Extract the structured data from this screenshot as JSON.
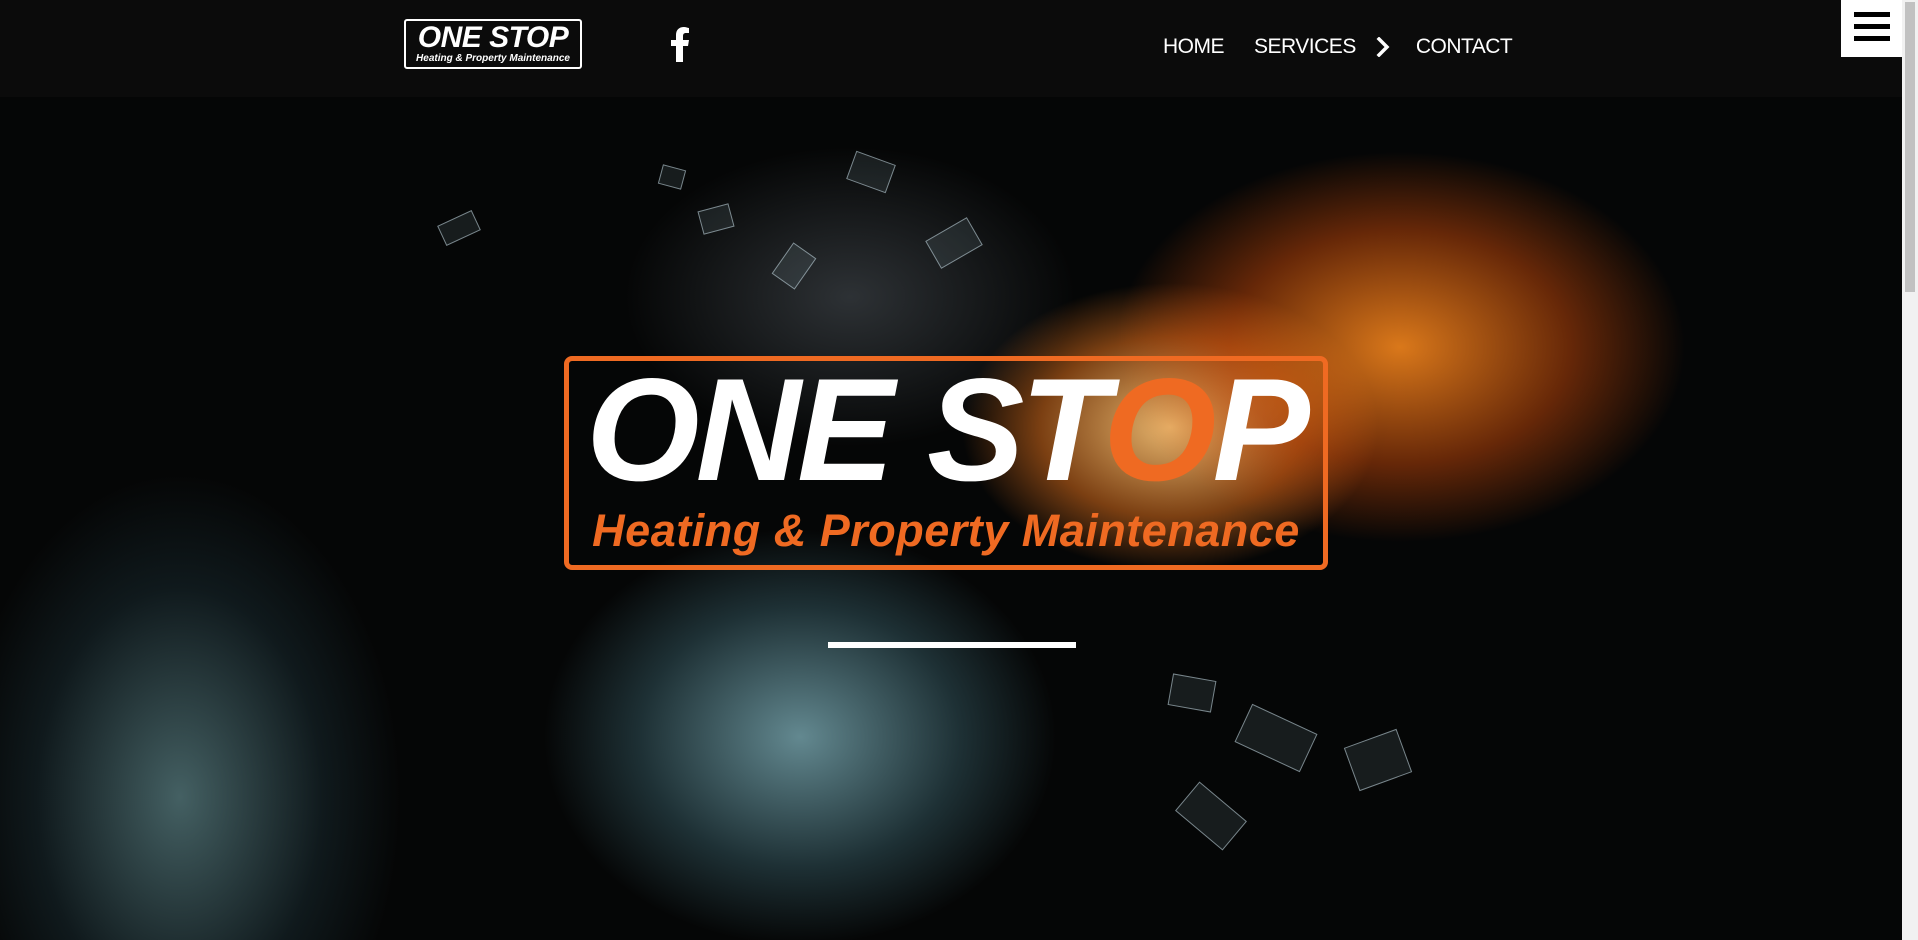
{
  "header": {
    "logo": {
      "main": "ONE STOP",
      "tagline": "Heating & Property Maintenance"
    },
    "social_icon": "facebook-icon",
    "nav": [
      {
        "label": "HOME"
      },
      {
        "label": "SERVICES"
      },
      {
        "label": "CONTACT"
      }
    ],
    "services_chevron_icon": "chevron-right-icon",
    "menu_icon": "hamburger-menu-icon"
  },
  "hero": {
    "logo": {
      "title_part1": "ONE ST",
      "title_o": "O",
      "title_part2": "P",
      "tagline": "Heating & Property Maintenance"
    }
  },
  "colors": {
    "header_bg": "#0b0b0b",
    "accent": "#ef6a22",
    "text": "#ffffff"
  }
}
